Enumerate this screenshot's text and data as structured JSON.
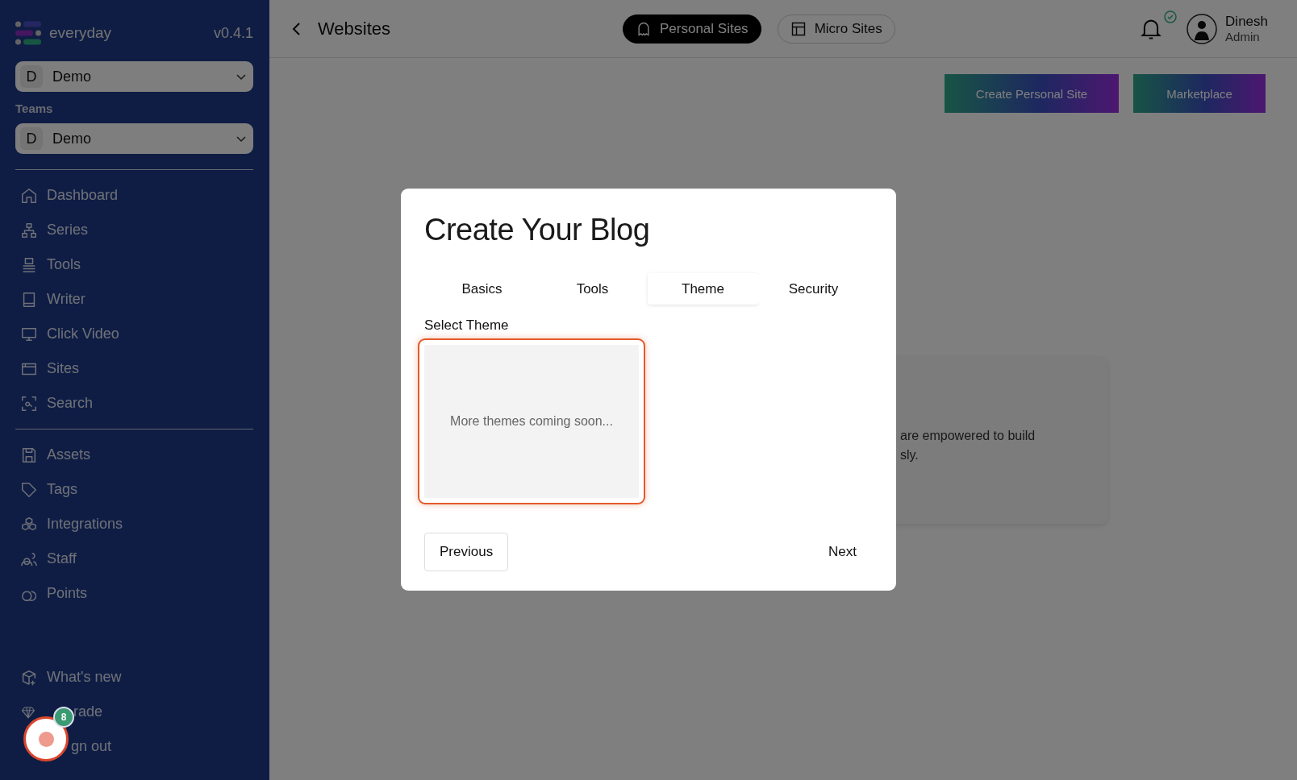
{
  "sidebar": {
    "brand": "everyday",
    "version": "v0.4.1",
    "workspace": {
      "initial": "D",
      "name": "Demo"
    },
    "teams_label": "Teams",
    "team": {
      "initial": "D",
      "name": "Demo"
    },
    "nav": [
      "Dashboard",
      "Series",
      "Tools",
      "Writer",
      "Click Video",
      "Sites",
      "Search"
    ],
    "nav2": [
      "Assets",
      "Tags",
      "Integrations",
      "Staff",
      "Points"
    ],
    "footer": [
      "What's new",
      "rade",
      "gn out"
    ]
  },
  "header": {
    "title": "Websites",
    "tabs": [
      {
        "label": "Personal Sites",
        "selected": true
      },
      {
        "label": "Micro Sites",
        "selected": false
      }
    ],
    "user": {
      "name": "Dinesh",
      "role": "Admin"
    }
  },
  "actions": [
    "Create Personal Site",
    "Marketplace"
  ],
  "background_card": {
    "lines": [
      "are empowered to build",
      "sly."
    ]
  },
  "modal": {
    "title": "Create Your Blog",
    "tabs": [
      {
        "label": "Basics",
        "selected": false
      },
      {
        "label": "Tools",
        "selected": false
      },
      {
        "label": "Theme",
        "selected": true
      },
      {
        "label": "Security",
        "selected": false
      }
    ],
    "section_label": "Select Theme",
    "themes": [
      {
        "text": "More themes coming soon...",
        "selected": true
      }
    ],
    "previous": "Previous",
    "next": "Next"
  },
  "launcher": {
    "badge": "8"
  }
}
